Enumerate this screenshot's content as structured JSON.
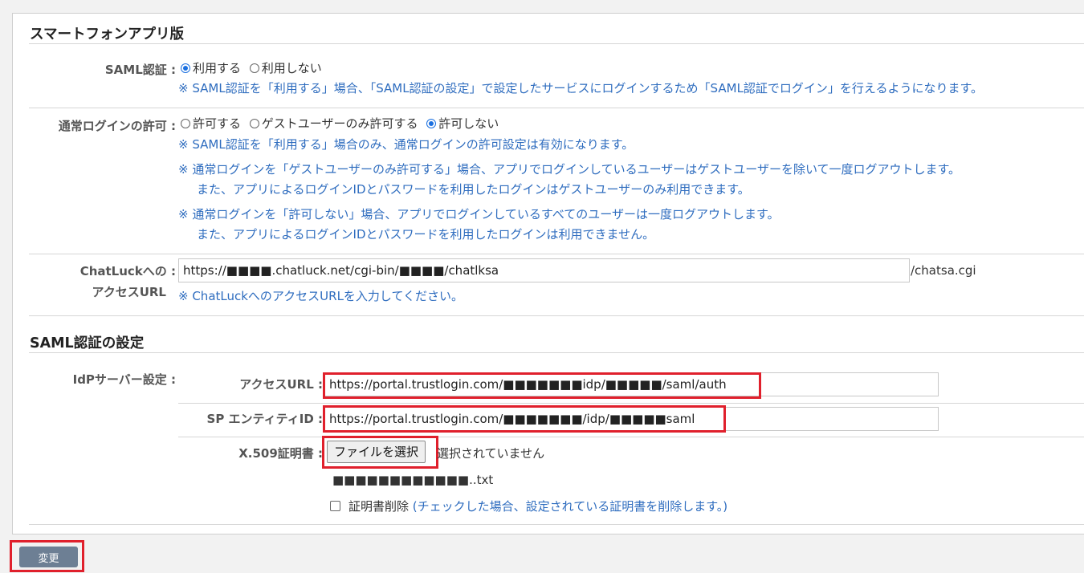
{
  "smartphone": {
    "title": "スマートフォンアプリ版",
    "saml_label": "SAML認証 :",
    "saml_options": [
      "利用する",
      "利用しない"
    ],
    "saml_selected": 0,
    "saml_note": "※ SAML認証を「利用する」場合、「SAML認証の設定」で設定したサービスにログインするため「SAML認証でログイン」を行えるようになります。",
    "login_label": "通常ログインの許可 :",
    "login_options": [
      "許可する",
      "ゲストユーザーのみ許可する",
      "許可しない"
    ],
    "login_selected": 2,
    "login_notes": [
      "※ SAML認証を「利用する」場合のみ、通常ログインの許可設定は有効になります。",
      "※ 通常ログインを「ゲストユーザーのみ許可する」場合、アプリでログインしているユーザーはゲストユーザーを除いて一度ログアウトします。",
      "また、アプリによるログインIDとパスワードを利用したログインはゲストユーザーのみ利用できます。",
      "※ 通常ログインを「許可しない」場合、アプリでログインしているすべてのユーザーは一度ログアウトします。",
      "また、アプリによるログインIDとパスワードを利用したログインは利用できません。"
    ],
    "url_label_1": "ChatLuckへの :",
    "url_label_2": "アクセスURL",
    "url_value": "https://■■■■.chatluck.net/cgi-bin/■■■■/chatlksa",
    "url_suffix": "/chatsa.cgi",
    "url_note": "※ ChatLuckへのアクセスURLを入力してください。"
  },
  "saml_settings": {
    "title": "SAML認証の設定",
    "idp_label": "IdPサーバー設定 :",
    "access_url_label": "アクセスURL :",
    "access_url_value": "https://portal.trustlogin.com/■■■■■■■idp/■■■■■/saml/auth",
    "sp_entity_label": "SP エンティティID :",
    "sp_entity_value": "https://portal.trustlogin.com/■■■■■■■/idp/■■■■■saml",
    "cert_label": "X.509証明書 :",
    "file_button": "ファイルを選択",
    "file_status": "選択されていません",
    "cert_filename": "■■■■■■■■■■■■..txt",
    "delete_cert_label": "証明書削除",
    "delete_cert_note": "(チェックした場合、設定されている証明書を削除します。)"
  },
  "submit_label": "変更",
  "colors": {
    "note_blue": "#2f6dbf",
    "highlight_red": "#e0202c",
    "submit_bg": "#6d7f94",
    "radio_blue": "#1a6fe0"
  }
}
